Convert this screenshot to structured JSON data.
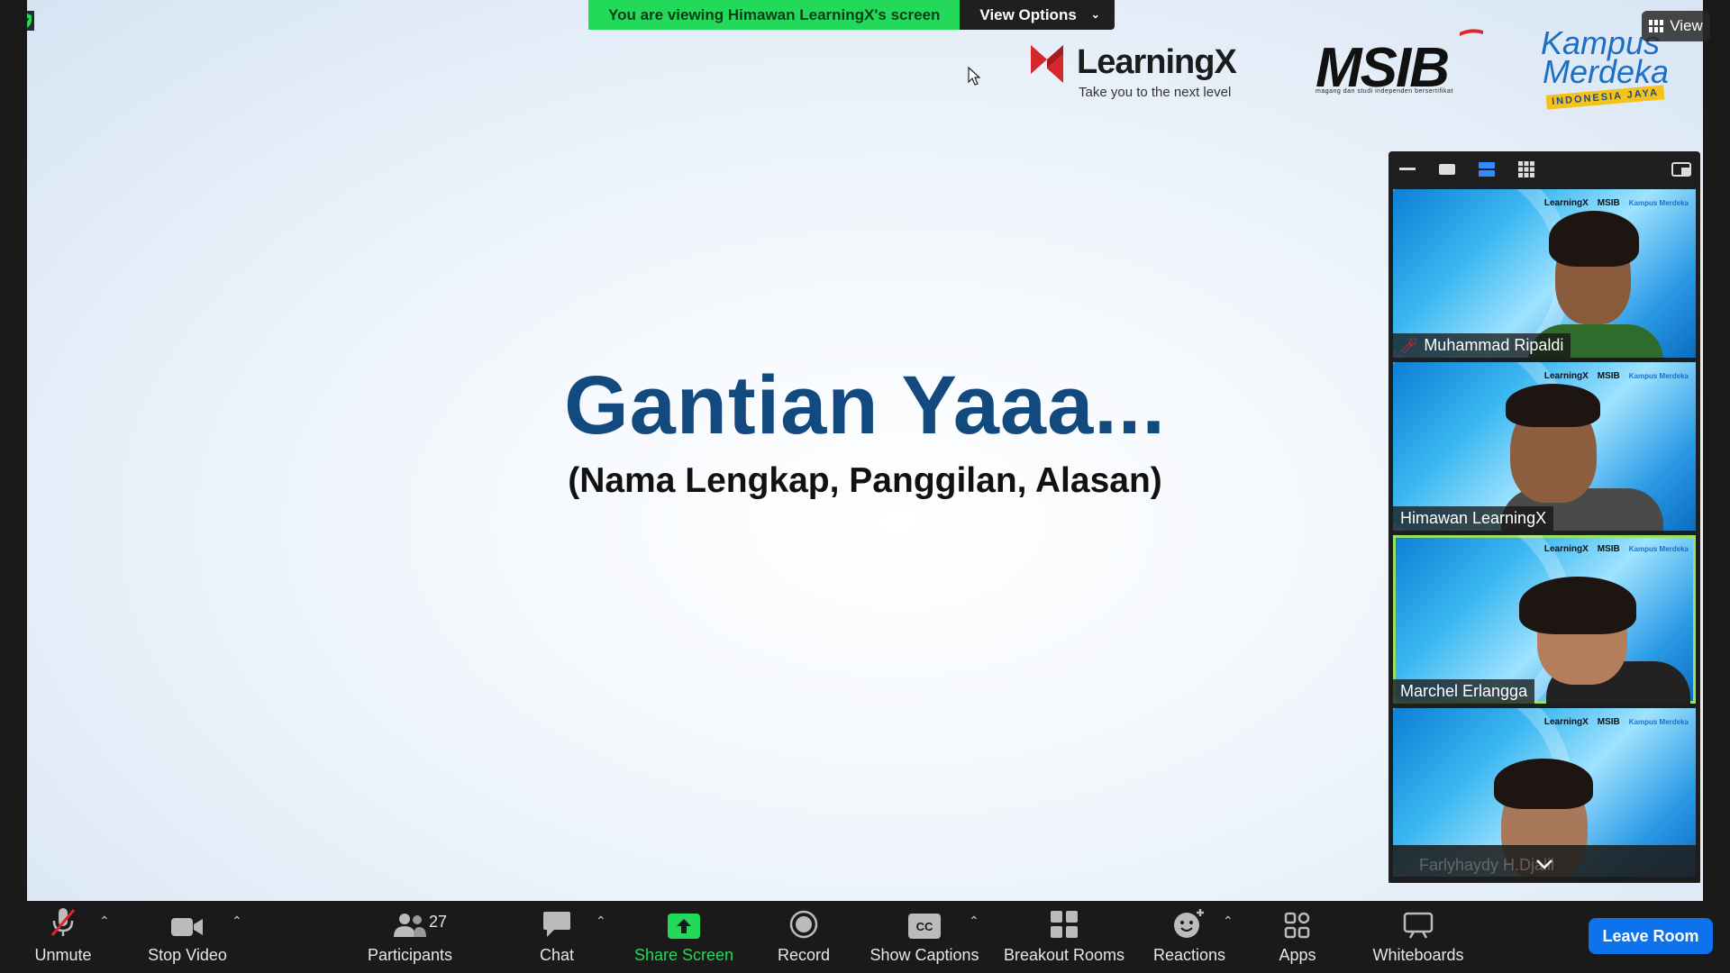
{
  "banner": {
    "viewing_text": "You are viewing Himawan LearningX's screen",
    "view_options": "View Options"
  },
  "view_button": "View",
  "logos": {
    "learningx": "LearningX",
    "learningx_tag": "Take you to the next level",
    "msib": "MSIB",
    "msib_sub": "magang dan studi independen bersertifikat",
    "kampus_1": "Kampus",
    "kampus_2": "Merdeka",
    "kampus_3": "INDONESIA JAYA"
  },
  "slide": {
    "title": "Gantian Yaaa...",
    "subtitle": "(Nama Lengkap, Panggilan, Alasan)"
  },
  "gallery": {
    "tiles": [
      {
        "name": "Muhammad Ripaldi",
        "muted": true,
        "active": false
      },
      {
        "name": "Himawan LearningX",
        "muted": false,
        "active": false
      },
      {
        "name": "Marchel Erlangga",
        "muted": false,
        "active": true
      },
      {
        "name": "Farlyhaydy H.Djalil",
        "muted": true,
        "active": false
      }
    ],
    "mini_logo_1": "LearningX",
    "mini_logo_2": "MSIB",
    "mini_logo_3": "Kampus Merdeka"
  },
  "toolbar": {
    "unmute": "Unmute",
    "stop_video": "Stop Video",
    "participants": "Participants",
    "participants_count": "27",
    "chat": "Chat",
    "share_screen": "Share Screen",
    "record": "Record",
    "show_captions": "Show Captions",
    "breakout_rooms": "Breakout Rooms",
    "reactions": "Reactions",
    "apps": "Apps",
    "whiteboards": "Whiteboards",
    "leave": "Leave Room"
  },
  "colors": {
    "accent_green": "#23d959",
    "leave_blue": "#0e72ed",
    "slide_title": "#124a7f",
    "active_border": "#96e063"
  }
}
